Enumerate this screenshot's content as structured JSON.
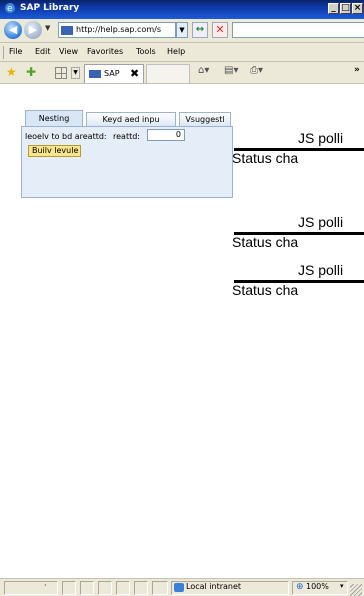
{
  "window": {
    "title": "SAP Library",
    "controls": {
      "minimize": "_",
      "maximize": "□",
      "close": "×"
    }
  },
  "address_bar": {
    "url": "http://help.sap.com/s",
    "back_symbol": "◀",
    "forward_symbol": "▶",
    "go_symbol": "↔",
    "stop_symbol": "✕"
  },
  "menu": {
    "items": [
      "File",
      "Edit",
      "View",
      "Favorites",
      "Tools",
      "Help"
    ]
  },
  "favorites_bar": {
    "tab_label": "SAP",
    "tab_close": "✖",
    "chevron": "»"
  },
  "panel": {
    "tabs": [
      "Nesting",
      "Keyd aed inpu",
      "Vsuggestl"
    ],
    "active_tab_index": 0,
    "field_label": "leoelv to bd areattd:",
    "field_label2": "reattd:",
    "field_value": "0",
    "button_label": "Builv levule"
  },
  "js_blocks": [
    {
      "js_text": "JS polli",
      "status_text": "Status cha"
    },
    {
      "js_text": "JS polli",
      "status_text": "Status cha"
    },
    {
      "js_text": "JS polli",
      "status_text": "Status cha"
    }
  ],
  "status_bar": {
    "done_text": "·",
    "zone_label": "Local intranet",
    "zoom_label": "100%",
    "zoom_dropdown": "▾"
  },
  "colors": {
    "titlebar": "#0d3aa8",
    "chrome": "#ece9d8",
    "panel_bg": "#e4edf8",
    "button_bg": "#f8e58c"
  }
}
